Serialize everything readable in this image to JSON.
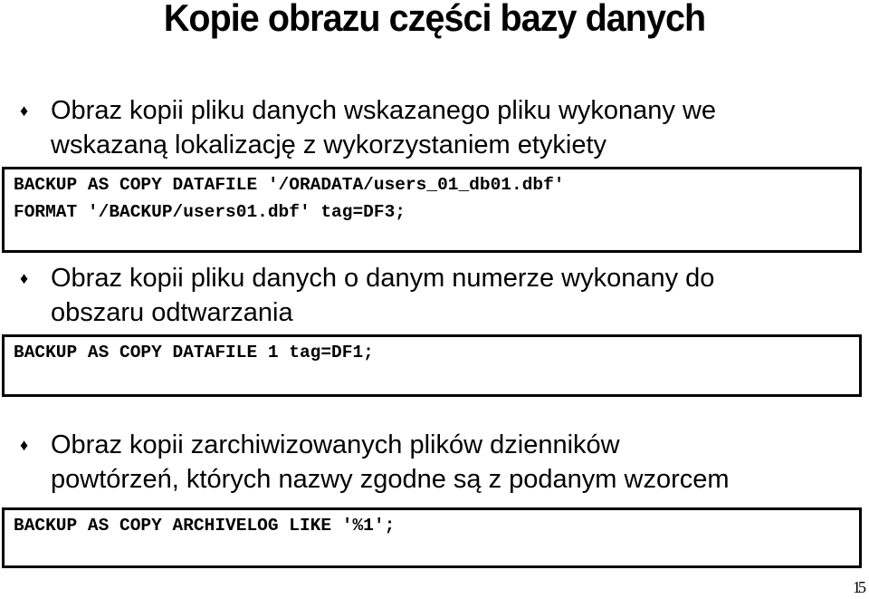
{
  "slide": {
    "title": "Kopie obrazu części bazy danych",
    "bullet_icon": "diamond-bullet-icon",
    "sections": [
      {
        "bullet_lines": [
          "Obraz kopii pliku danych wskazanego pliku wykonany we",
          "wskazaną lokalizację z wykorzystaniem etykiety"
        ],
        "code_lines": [
          "BACKUP AS COPY DATAFILE '/ORADATA/users_01_db01.dbf'",
          "FORMAT '/BACKUP/users01.dbf' tag=DF3;"
        ]
      },
      {
        "bullet_lines": [
          "Obraz kopii pliku danych o danym numerze wykonany do",
          "obszaru odtwarzania"
        ],
        "code_lines": [
          "BACKUP AS COPY DATAFILE 1 tag=DF1;"
        ]
      },
      {
        "bullet_lines": [
          "Obraz kopii zarchiwizowanych plików dzienników",
          "powtórzeń, których nazwy zgodne są z podanym wzorcem"
        ],
        "code_lines": [
          "BACKUP AS COPY ARCHIVELOG LIKE '%1';"
        ]
      }
    ],
    "page_number": "15",
    "bullet_glyph": "♦"
  }
}
